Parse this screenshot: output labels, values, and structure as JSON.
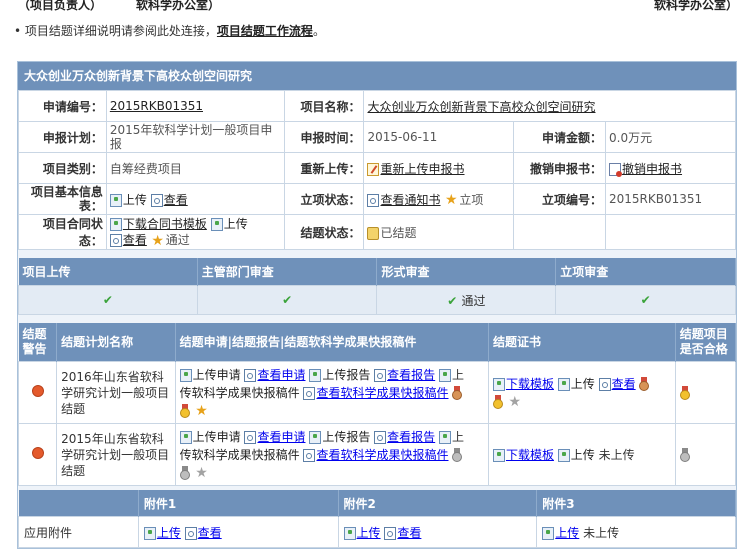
{
  "header_fragment": {
    "left1": "（项目负责人）",
    "left2": "软科学办公室）",
    "right": "软科学办公室）"
  },
  "note": {
    "text": "项目结题详细说明请参阅此处连接，",
    "link": "项目结题工作流程",
    "suffix": "。"
  },
  "project": {
    "title": "大众创业万众创新背景下高校众创空间研究",
    "rows": {
      "apply_no_label": "申请编号：",
      "apply_no": "2015RKB01351",
      "name_label": "项目名称：",
      "name": "大众创业万众创新背景下高校众创空间研究",
      "plan_label": "申报计划：",
      "plan": "2015年软科学计划一般项目申报",
      "time_label": "申报时间：",
      "time": "2015-06-11",
      "amount_label": "申请金额：",
      "amount": "0.0万元",
      "type_label": "项目类别：",
      "type": "自筹经费项目",
      "reupload_label": "重新上传：",
      "reupload": "重新上传申报书",
      "revoke_label": "撤销申报书：",
      "revoke": "撤销申报书",
      "basic_label": "项目基本信息表：",
      "upload": "上传",
      "view": "查看",
      "setup_label": "立项状态：",
      "setup_notice": "查看通知书",
      "setup_status": "立项",
      "setup_no_label": "立项编号：",
      "setup_no": "2015RKB01351",
      "contract_label": "项目合同状态：",
      "contract_download": "下载合同书模板",
      "contract_status": "通过",
      "close_label": "结题状态：",
      "close_status": "已结题"
    }
  },
  "flow": {
    "headers": [
      "项目上传",
      "主管部门审查",
      "形式审查",
      "立项审查"
    ],
    "cells": [
      "✔",
      "✔",
      "✔ 通过",
      "✔"
    ]
  },
  "conclusion": {
    "headers": {
      "warn": "结题警告",
      "plan": "结题计划名称",
      "apply": "结题申请|结题报告|结题软科学成果快报稿件",
      "cert": "结题证书",
      "pass": "结题项目是否合格"
    },
    "rows": [
      {
        "plan": "2016年山东省软科学研究计划一般项目结题",
        "upload_apply": "上传申请",
        "view_apply": "查看申请",
        "upload_report": "上传报告",
        "view_report": "查看报告",
        "upload_prefix": "上",
        "upload_quick": "传软科学成果快报稿件",
        "view_quick": "查看软科学成果快报稿件",
        "cert_download": "下载模板",
        "cert_upload": "上传",
        "cert_view": "查看",
        "cert_status": ""
      },
      {
        "plan": "2015年山东省软科学研究计划一般项目结题",
        "upload_apply": "上传申请",
        "view_apply": "查看申请",
        "upload_report": "上传报告",
        "view_report": "查看报告",
        "upload_prefix": "上",
        "upload_quick": "传软科学成果快报稿件",
        "view_quick": "查看软科学成果快报稿件",
        "cert_download": "下载模板",
        "cert_upload": "上传",
        "cert_view": "",
        "cert_status": "未上传"
      }
    ]
  },
  "attachments": {
    "headers": [
      "",
      "附件1",
      "附件2",
      "附件3"
    ],
    "row_label": "应用附件",
    "a1_upload": "上传",
    "a1_view": "查看",
    "a2_upload": "上传",
    "a2_view": "查看",
    "a3_upload": "上传",
    "a3_status": "未上传"
  },
  "colors": {
    "header_blue": "#6f91ba",
    "check_green": "#3aa33a",
    "warn_orange": "#e45a2c"
  }
}
